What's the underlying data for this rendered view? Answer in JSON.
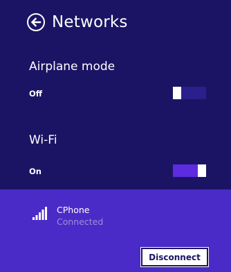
{
  "header": {
    "title": "Networks",
    "back_icon": "back-arrow-circle-icon"
  },
  "airplane_mode": {
    "label": "Airplane mode",
    "state": "Off",
    "is_on": false
  },
  "wifi": {
    "label": "Wi-Fi",
    "state": "On",
    "is_on": true
  },
  "network": {
    "name": "CPhone",
    "status": "Connected",
    "signal_icon": "signal-strength-icon",
    "signal_bars": 5
  },
  "actions": {
    "disconnect_label": "Disconnect"
  },
  "colors": {
    "background": "#1b1464",
    "selected_network_bg": "#4b2bc7",
    "toggle_on_track": "#5d2be0",
    "toggle_off_track": "#2a1f8c",
    "status_text": "#9c8fd9"
  }
}
